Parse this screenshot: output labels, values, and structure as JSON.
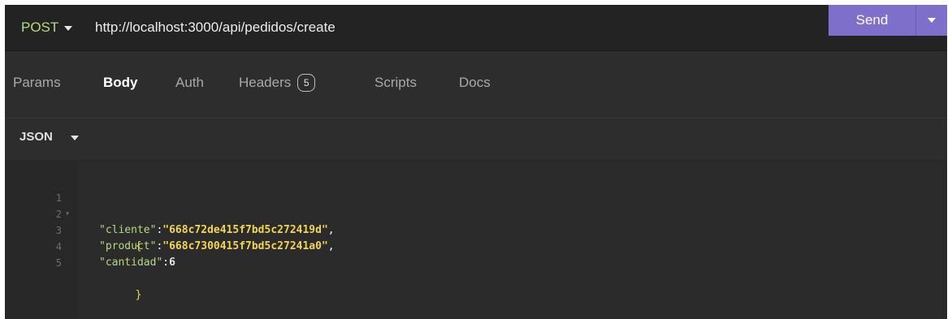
{
  "request": {
    "method": "POST",
    "url": "http://localhost:3000/api/pedidos/create",
    "send_label": "Send"
  },
  "tabs": [
    {
      "label": "Params",
      "active": false
    },
    {
      "label": "Body",
      "active": true
    },
    {
      "label": "Auth",
      "active": false
    },
    {
      "label": "Headers",
      "active": false,
      "badge": "5"
    },
    {
      "label": "Scripts",
      "active": false
    },
    {
      "label": "Docs",
      "active": false
    }
  ],
  "body": {
    "format": "JSON",
    "lines": [
      {
        "num": "1",
        "open": "{"
      },
      {
        "num": "2",
        "key": "\"cliente\"",
        "colon": ":",
        "value": "\"668c72de415f7bd5c272419d\"",
        "comma": ","
      },
      {
        "num": "3",
        "key": "\"product\"",
        "colon": ":",
        "value": "\"668c7300415f7bd5c27241a0\"",
        "comma": ","
      },
      {
        "num": "4",
        "key": "\"cantidad\"",
        "colon": ":",
        "value": "6"
      },
      {
        "num": "5",
        "close": "}"
      }
    ]
  },
  "colors": {
    "accent": "#7e6fcb",
    "method": "#b6d97f",
    "json_key": "#b6d97f",
    "json_string": "#f2d64b"
  }
}
